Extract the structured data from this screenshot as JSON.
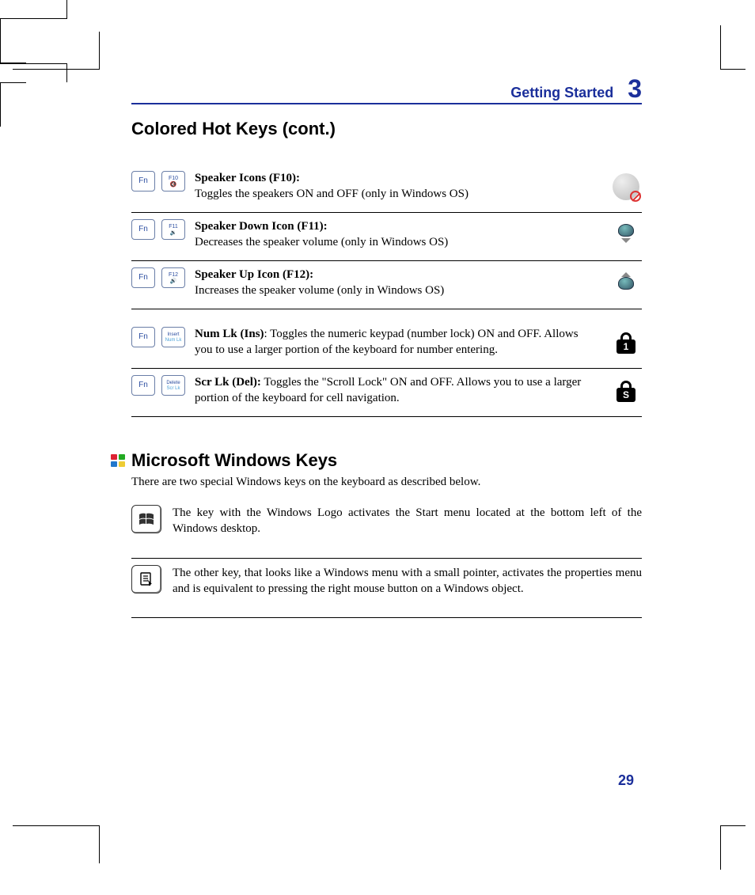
{
  "header": {
    "running_title": "Getting Started",
    "chapter_number": "3"
  },
  "section_title": "Colored Hot Keys (cont.)",
  "hotkeys": [
    {
      "key1": "Fn",
      "key2_top": "F10",
      "key2_bot": "🔇",
      "icon": "speaker-mute-icon",
      "bold": "Speaker Icons (F10):",
      "text": "Toggles the speakers ON and OFF (only in Windows OS)"
    },
    {
      "key1": "Fn",
      "key2_top": "F11",
      "key2_bot": "🔉",
      "icon": "speaker-down-icon",
      "bold": "Speaker Down Icon (F11):",
      "text": "Decreases the speaker volume (only in Windows OS)"
    },
    {
      "key1": "Fn",
      "key2_top": "F12",
      "key2_bot": "🔊",
      "icon": "speaker-up-icon",
      "bold": "Speaker Up Icon (F12):",
      "text": "Increases the speaker volume (only in Windows OS)"
    },
    {
      "key1": "Fn",
      "key2_top": "Insert",
      "key2_bot": "Num Lk",
      "icon": "num-lock-icon",
      "lock_char": "1",
      "bold": "Num Lk (Ins)",
      "text": ": Toggles the numeric keypad (number lock) ON and OFF. Allows you to use a larger portion of the keyboard for number entering."
    },
    {
      "key1": "Fn",
      "key2_top": "Delete",
      "key2_bot": "Scr Lk",
      "icon": "scroll-lock-icon",
      "lock_char": "S",
      "bold": "Scr Lk (Del):",
      "text": " Toggles the \"Scroll Lock\" ON and OFF. Allows you to use a larger portion of the keyboard for cell navigation."
    }
  ],
  "sub_section": {
    "title": "Microsoft Windows Keys",
    "intro": "There are two special Windows keys on the keyboard as described below.",
    "items": [
      {
        "icon": "windows-logo-key-icon",
        "text": "The key with the Windows Logo activates the Start menu located at the bottom left of the Windows desktop."
      },
      {
        "icon": "menu-key-icon",
        "text": "The other key, that looks like a Windows menu with a small pointer, activates the properties menu and is equivalent to pressing the right mouse button on a Windows object."
      }
    ]
  },
  "page_number": "29"
}
